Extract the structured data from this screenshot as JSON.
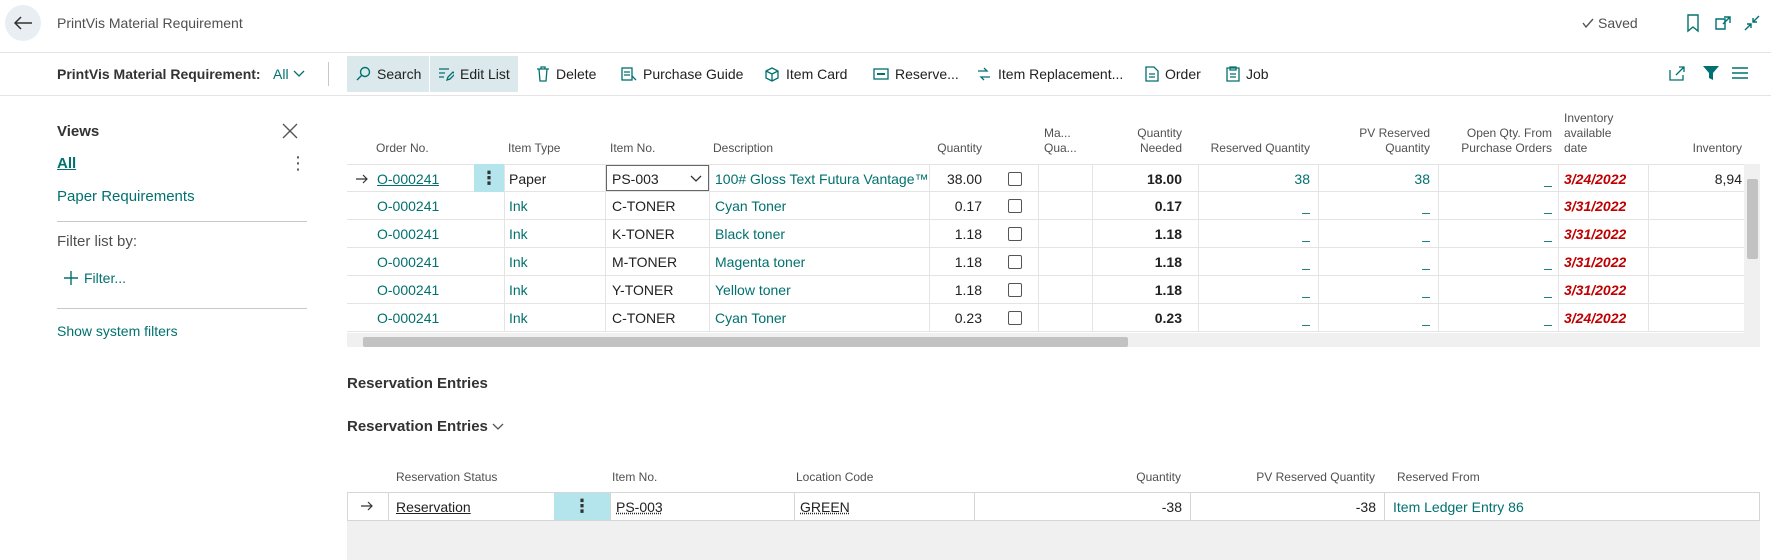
{
  "page": {
    "title": "PrintVis Material Requirement",
    "saved_label": "Saved"
  },
  "actionbar": {
    "label": "PrintVis Material Requirement:",
    "filter_value": "All",
    "actions": [
      "Search",
      "Edit List",
      "Delete",
      "Purchase Guide",
      "Item Card",
      "Reserve...",
      "Item Replacement...",
      "Order",
      "Job"
    ]
  },
  "views": {
    "title": "Views",
    "items": [
      "All",
      "Paper Requirements"
    ],
    "filter_by_label": "Filter list by:",
    "add_filter_label": "Filter...",
    "show_system_filters": "Show system filters"
  },
  "grid": {
    "columns": [
      "Order No.",
      "Item Type",
      "Item No.",
      "Description",
      "Quantity",
      "Ma... Qua...",
      "Quantity Needed",
      "Reserved Quantity",
      "PV Reserved Quantity",
      "Open Qty. From Purchase Orders",
      "Inventory available date",
      "Inventory"
    ],
    "rows": [
      {
        "order_no": "O-000241",
        "item_type": "Paper",
        "item_no": "PS-003",
        "description": "100# Gloss Text Futura Vantage™",
        "quantity": "38.00",
        "qty_needed": "18.00",
        "reserved_qty": "38",
        "pv_reserved_qty": "38",
        "open_qty": "_",
        "inv_date": "3/24/2022",
        "inventory": "8,94"
      },
      {
        "order_no": "O-000241",
        "item_type": "Ink",
        "item_no": "C-TONER",
        "description": "Cyan Toner",
        "quantity": "0.17",
        "qty_needed": "0.17",
        "reserved_qty": "_",
        "pv_reserved_qty": "_",
        "open_qty": "_",
        "inv_date": "3/31/2022",
        "inventory": ""
      },
      {
        "order_no": "O-000241",
        "item_type": "Ink",
        "item_no": "K-TONER",
        "description": "Black toner",
        "quantity": "1.18",
        "qty_needed": "1.18",
        "reserved_qty": "_",
        "pv_reserved_qty": "_",
        "open_qty": "_",
        "inv_date": "3/31/2022",
        "inventory": ""
      },
      {
        "order_no": "O-000241",
        "item_type": "Ink",
        "item_no": "M-TONER",
        "description": "Magenta toner",
        "quantity": "1.18",
        "qty_needed": "1.18",
        "reserved_qty": "_",
        "pv_reserved_qty": "_",
        "open_qty": "_",
        "inv_date": "3/31/2022",
        "inventory": ""
      },
      {
        "order_no": "O-000241",
        "item_type": "Ink",
        "item_no": "Y-TONER",
        "description": "Yellow toner",
        "quantity": "1.18",
        "qty_needed": "1.18",
        "reserved_qty": "_",
        "pv_reserved_qty": "_",
        "open_qty": "_",
        "inv_date": "3/31/2022",
        "inventory": ""
      },
      {
        "order_no": "O-000241",
        "item_type": "Ink",
        "item_no": "C-TONER",
        "description": "Cyan Toner",
        "quantity": "0.23",
        "qty_needed": "0.23",
        "reserved_qty": "_",
        "pv_reserved_qty": "_",
        "open_qty": "_",
        "inv_date": "3/24/2022",
        "inventory": ""
      }
    ]
  },
  "reservation": {
    "section_title": "Reservation Entries",
    "subsection_title": "Reservation Entries",
    "columns": [
      "Reservation Status",
      "Item No.",
      "Location Code",
      "Quantity",
      "PV Reserved Quantity",
      "Reserved From"
    ],
    "row": {
      "status": "Reservation",
      "item_no": "PS-003",
      "location_code": "GREEN",
      "quantity": "-38",
      "pv_reserved_qty": "-38",
      "reserved_from": "Item Ledger Entry 86"
    }
  },
  "colors": {
    "accent": "#00716f",
    "date_red": "#c00000",
    "selection": "#b5e5ec"
  },
  "icons": [
    "back-arrow-icon",
    "checkmark-icon",
    "bookmark-icon",
    "open-new-window-icon",
    "collapse-icon",
    "chevron-down-icon",
    "search-icon",
    "edit-list-icon",
    "delete-icon",
    "purchase-guide-icon",
    "item-card-icon",
    "reserve-icon",
    "item-replacement-icon",
    "order-icon",
    "job-icon",
    "share-icon",
    "filter-icon",
    "list-icon",
    "close-icon",
    "plus-icon",
    "arrow-right-icon"
  ]
}
